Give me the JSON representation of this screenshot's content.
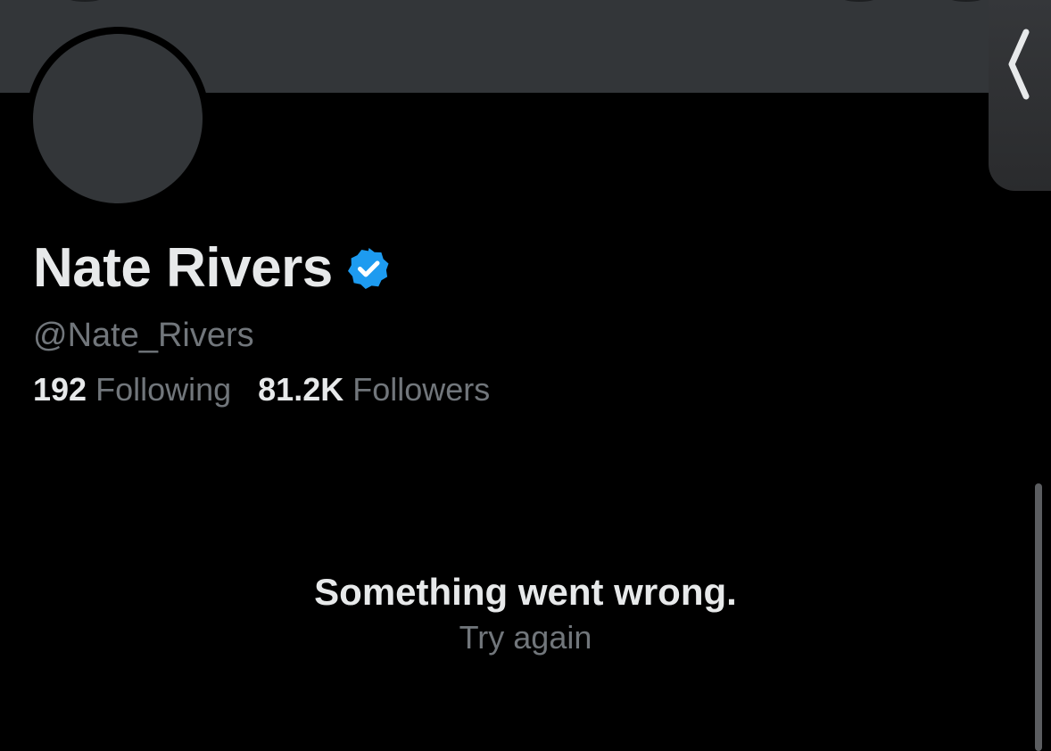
{
  "profile": {
    "display_name": "Nate Rivers",
    "handle": "@Nate_Rivers",
    "verified_icon": "verified-badge-icon",
    "following_count": "192",
    "following_label": "Following",
    "followers_count": "81.2K",
    "followers_label": "Followers"
  },
  "error": {
    "title": "Something went wrong.",
    "retry_label": "Try again"
  },
  "icons": {
    "back": "chevron-left-icon",
    "verified": "verified-badge-icon"
  },
  "colors": {
    "background": "#000000",
    "banner": "#333639",
    "primary_text": "#e7e9ea",
    "secondary_text": "#71767b",
    "verified_blue": "#1d9bf0"
  }
}
